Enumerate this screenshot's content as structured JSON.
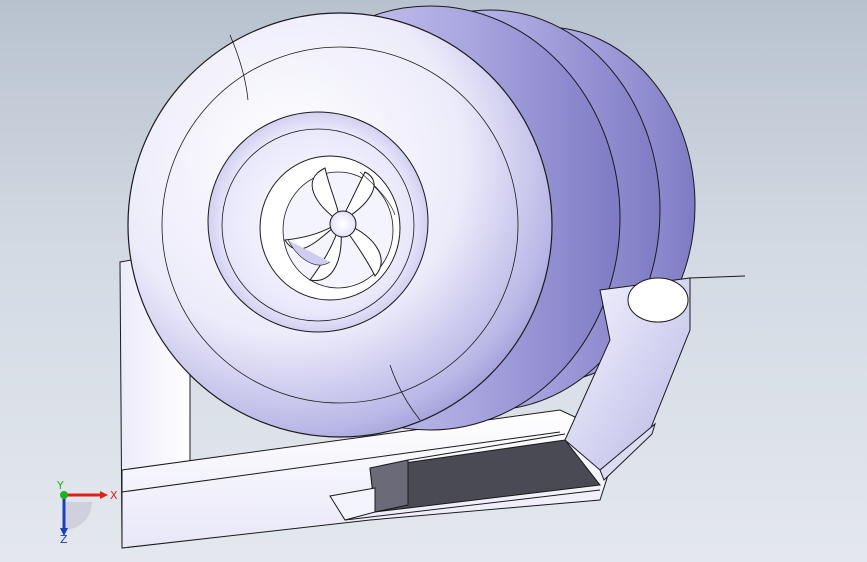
{
  "viewport": {
    "background_top": "#b8c2cf",
    "background_bottom": "#e4e8ee",
    "model_fill": "#ffffff",
    "model_shade": "#9a98d6",
    "edge_color": "#1a1a1a",
    "panel_dark": "#4a4a55"
  },
  "triad": {
    "x_label": "X",
    "y_label": "Y",
    "z_label": "Z",
    "x_color": "#e0201b",
    "y_color": "#1fb21f",
    "z_color": "#1d3fbf"
  }
}
